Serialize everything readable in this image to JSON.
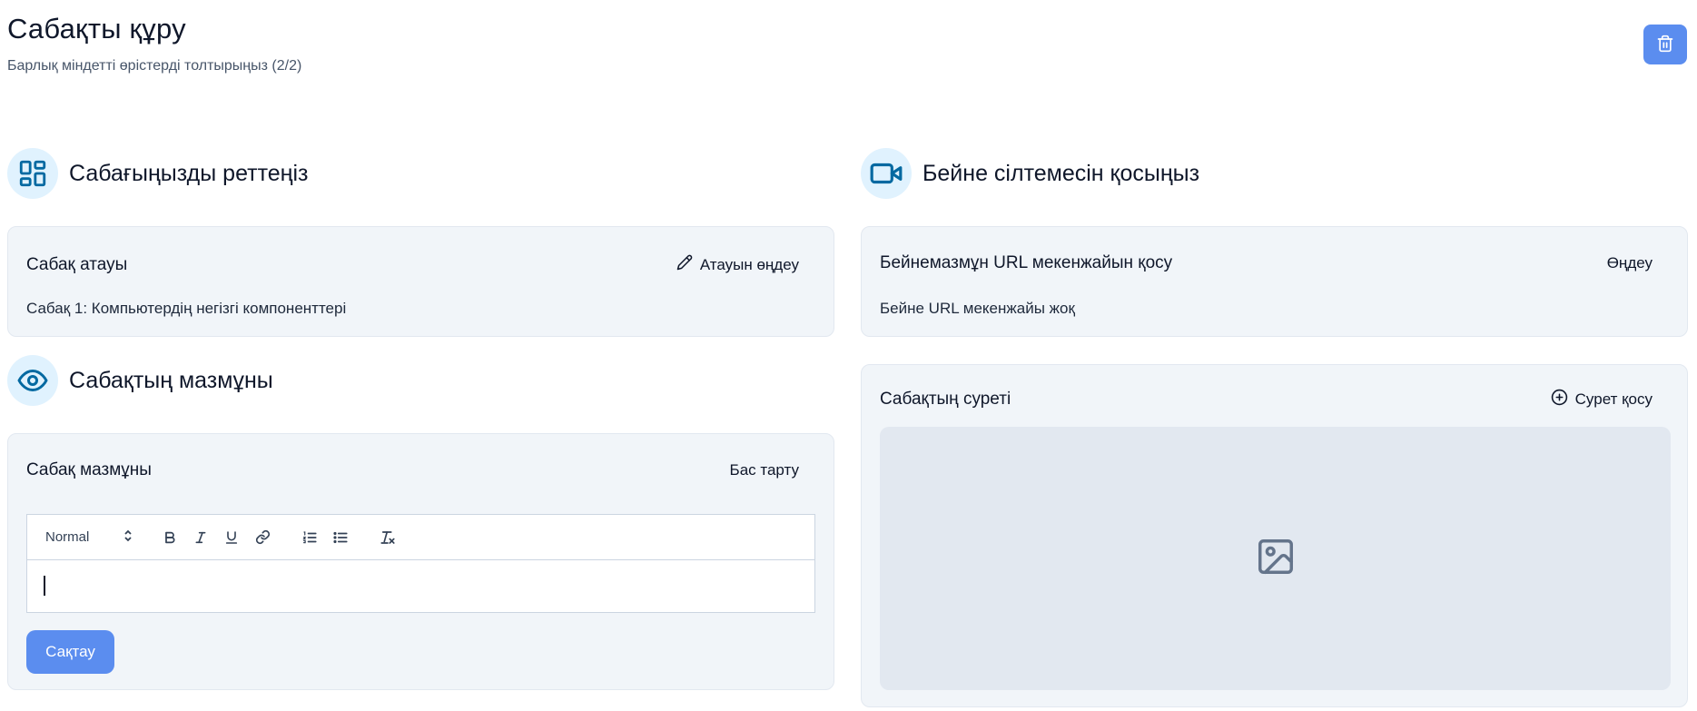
{
  "header": {
    "title": "Сабақты құру",
    "subtitle": "Барлық міндетті өрістерді толтырыңыз (2/2)",
    "delete_icon": "trash-icon"
  },
  "left": {
    "customize": {
      "heading": "Сабағыңызды реттеңіз",
      "icon": "layout-dashboard-icon",
      "card": {
        "title": "Сабақ атауы",
        "action_label": "Атауын өңдеу",
        "action_icon": "pencil-icon",
        "value": "Сабақ 1: Компьютердің негізгі компоненттері"
      }
    },
    "content": {
      "heading": "Сабақтың мазмұны",
      "icon": "eye-icon",
      "card": {
        "title": "Сабақ мазмұны",
        "action_label": "Бас тарту",
        "editor": {
          "format_select": "Normal",
          "tools": [
            "bold-icon",
            "italic-icon",
            "underline-icon",
            "link-icon",
            "ordered-list-icon",
            "bullet-list-icon",
            "clear-format-icon"
          ]
        },
        "save_label": "Сақтау"
      }
    }
  },
  "right": {
    "video": {
      "heading": "Бейне сілтемесін қосыңыз",
      "icon": "video-icon",
      "card": {
        "title": "Бейнемазмұн URL мекенжайын қосу",
        "action_label": "Өңдеу",
        "value": "Бейне URL мекенжайы жоқ"
      }
    },
    "image": {
      "card": {
        "title": "Сабақтың суреті",
        "action_label": "Сурет қосу",
        "action_icon": "plus-circle-icon",
        "placeholder_icon": "image-icon"
      }
    }
  },
  "colors": {
    "primary": "#5b8def",
    "icon_accent": "#0369a1",
    "icon_bg": "#e0f2fe",
    "card_bg": "#f1f5f9"
  }
}
